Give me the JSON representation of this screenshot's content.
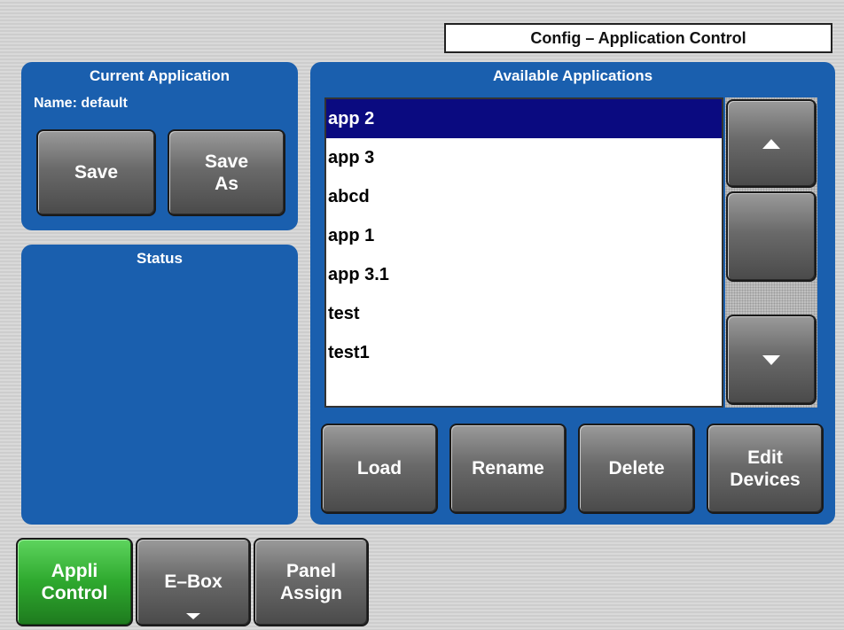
{
  "header": {
    "title": "Config – Application Control"
  },
  "current_application": {
    "title": "Current Application",
    "name_line": "Name: default",
    "save_label": "Save",
    "save_as_label": "Save\nAs"
  },
  "status": {
    "title": "Status"
  },
  "available_applications": {
    "title": "Available Applications",
    "items": [
      "app 2",
      "app 3",
      "abcd",
      "app 1",
      "app 3.1",
      "test",
      "test1"
    ],
    "selected": "app 2",
    "load_label": "Load",
    "rename_label": "Rename",
    "delete_label": "Delete",
    "edit_devices_label": "Edit\nDevices"
  },
  "bottom_tabs": {
    "appli_control": "Appli\nControl",
    "ebox": "E–Box",
    "panel_assign": "Panel\nAssign"
  },
  "colors": {
    "panel_blue": "#1a5fae",
    "selection": "#0a0a80",
    "active_tab_green": "#2ea82e"
  },
  "icons": [
    "scroll-up-icon",
    "scroll-down-icon",
    "dropdown-arrow-icon"
  ]
}
